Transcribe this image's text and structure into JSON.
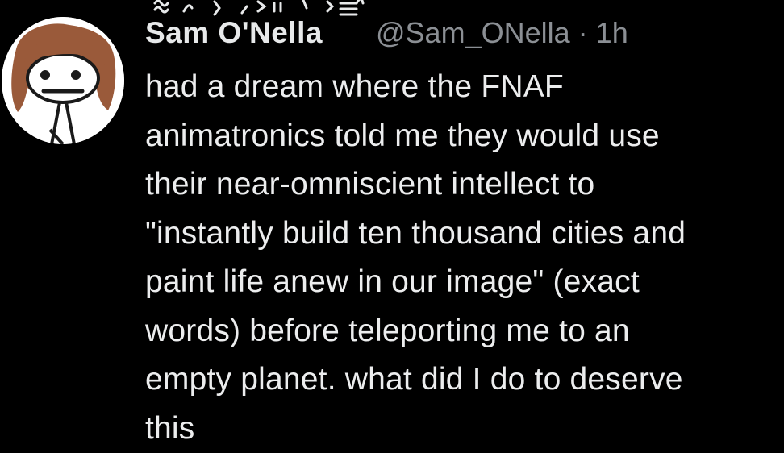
{
  "author": {
    "display_name": "Sam O'Nella",
    "handle": "@Sam_ONella",
    "separator": "·",
    "time_ago": "1h",
    "avatar_icon": "cartoon-stick-figure-avatar"
  },
  "tweet": {
    "lines": [
      "had a dream where the FNAF",
      "animatronics told me they would use",
      "their near-omniscient intellect to",
      "\"instantly build ten thousand cities and",
      "paint life anew in our image\" (exact",
      "words) before teleporting me to an",
      "empty planet. what did I do to deserve",
      "this"
    ]
  },
  "colors": {
    "background": "#000000",
    "text": "#ecedee",
    "muted": "#8b8f94",
    "hair": "#9a5a3a"
  }
}
